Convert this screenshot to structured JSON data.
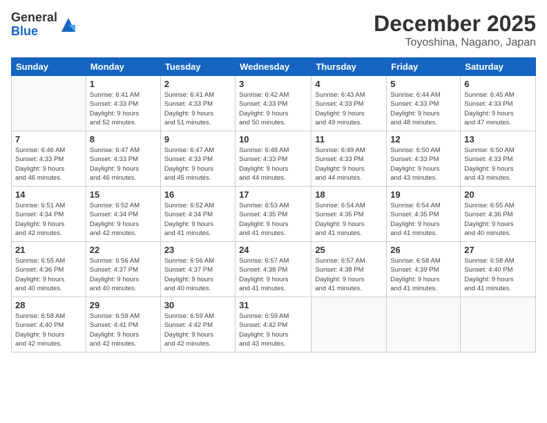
{
  "logo": {
    "general": "General",
    "blue": "Blue"
  },
  "header": {
    "month": "December 2025",
    "location": "Toyoshina, Nagano, Japan"
  },
  "weekdays": [
    "Sunday",
    "Monday",
    "Tuesday",
    "Wednesday",
    "Thursday",
    "Friday",
    "Saturday"
  ],
  "weeks": [
    [
      {
        "day": "",
        "info": ""
      },
      {
        "day": "1",
        "info": "Sunrise: 6:41 AM\nSunset: 4:33 PM\nDaylight: 9 hours\nand 52 minutes."
      },
      {
        "day": "2",
        "info": "Sunrise: 6:41 AM\nSunset: 4:33 PM\nDaylight: 9 hours\nand 51 minutes."
      },
      {
        "day": "3",
        "info": "Sunrise: 6:42 AM\nSunset: 4:33 PM\nDaylight: 9 hours\nand 50 minutes."
      },
      {
        "day": "4",
        "info": "Sunrise: 6:43 AM\nSunset: 4:33 PM\nDaylight: 9 hours\nand 49 minutes."
      },
      {
        "day": "5",
        "info": "Sunrise: 6:44 AM\nSunset: 4:33 PM\nDaylight: 9 hours\nand 48 minutes."
      },
      {
        "day": "6",
        "info": "Sunrise: 6:45 AM\nSunset: 4:33 PM\nDaylight: 9 hours\nand 47 minutes."
      }
    ],
    [
      {
        "day": "7",
        "info": "Sunrise: 6:46 AM\nSunset: 4:33 PM\nDaylight: 9 hours\nand 46 minutes."
      },
      {
        "day": "8",
        "info": "Sunrise: 6:47 AM\nSunset: 4:33 PM\nDaylight: 9 hours\nand 46 minutes."
      },
      {
        "day": "9",
        "info": "Sunrise: 6:47 AM\nSunset: 4:33 PM\nDaylight: 9 hours\nand 45 minutes."
      },
      {
        "day": "10",
        "info": "Sunrise: 6:48 AM\nSunset: 4:33 PM\nDaylight: 9 hours\nand 44 minutes."
      },
      {
        "day": "11",
        "info": "Sunrise: 6:49 AM\nSunset: 4:33 PM\nDaylight: 9 hours\nand 44 minutes."
      },
      {
        "day": "12",
        "info": "Sunrise: 6:50 AM\nSunset: 4:33 PM\nDaylight: 9 hours\nand 43 minutes."
      },
      {
        "day": "13",
        "info": "Sunrise: 6:50 AM\nSunset: 4:33 PM\nDaylight: 9 hours\nand 43 minutes."
      }
    ],
    [
      {
        "day": "14",
        "info": "Sunrise: 6:51 AM\nSunset: 4:34 PM\nDaylight: 9 hours\nand 42 minutes."
      },
      {
        "day": "15",
        "info": "Sunrise: 6:52 AM\nSunset: 4:34 PM\nDaylight: 9 hours\nand 42 minutes."
      },
      {
        "day": "16",
        "info": "Sunrise: 6:52 AM\nSunset: 4:34 PM\nDaylight: 9 hours\nand 41 minutes."
      },
      {
        "day": "17",
        "info": "Sunrise: 6:53 AM\nSunset: 4:35 PM\nDaylight: 9 hours\nand 41 minutes."
      },
      {
        "day": "18",
        "info": "Sunrise: 6:54 AM\nSunset: 4:35 PM\nDaylight: 9 hours\nand 41 minutes."
      },
      {
        "day": "19",
        "info": "Sunrise: 6:54 AM\nSunset: 4:35 PM\nDaylight: 9 hours\nand 41 minutes."
      },
      {
        "day": "20",
        "info": "Sunrise: 6:55 AM\nSunset: 4:36 PM\nDaylight: 9 hours\nand 40 minutes."
      }
    ],
    [
      {
        "day": "21",
        "info": "Sunrise: 6:55 AM\nSunset: 4:36 PM\nDaylight: 9 hours\nand 40 minutes."
      },
      {
        "day": "22",
        "info": "Sunrise: 6:56 AM\nSunset: 4:37 PM\nDaylight: 9 hours\nand 40 minutes."
      },
      {
        "day": "23",
        "info": "Sunrise: 6:56 AM\nSunset: 4:37 PM\nDaylight: 9 hours\nand 40 minutes."
      },
      {
        "day": "24",
        "info": "Sunrise: 6:57 AM\nSunset: 4:38 PM\nDaylight: 9 hours\nand 41 minutes."
      },
      {
        "day": "25",
        "info": "Sunrise: 6:57 AM\nSunset: 4:38 PM\nDaylight: 9 hours\nand 41 minutes."
      },
      {
        "day": "26",
        "info": "Sunrise: 6:58 AM\nSunset: 4:39 PM\nDaylight: 9 hours\nand 41 minutes."
      },
      {
        "day": "27",
        "info": "Sunrise: 6:58 AM\nSunset: 4:40 PM\nDaylight: 9 hours\nand 41 minutes."
      }
    ],
    [
      {
        "day": "28",
        "info": "Sunrise: 6:58 AM\nSunset: 4:40 PM\nDaylight: 9 hours\nand 42 minutes."
      },
      {
        "day": "29",
        "info": "Sunrise: 6:59 AM\nSunset: 4:41 PM\nDaylight: 9 hours\nand 42 minutes."
      },
      {
        "day": "30",
        "info": "Sunrise: 6:59 AM\nSunset: 4:42 PM\nDaylight: 9 hours\nand 42 minutes."
      },
      {
        "day": "31",
        "info": "Sunrise: 6:59 AM\nSunset: 4:42 PM\nDaylight: 9 hours\nand 43 minutes."
      },
      {
        "day": "",
        "info": ""
      },
      {
        "day": "",
        "info": ""
      },
      {
        "day": "",
        "info": ""
      }
    ]
  ]
}
